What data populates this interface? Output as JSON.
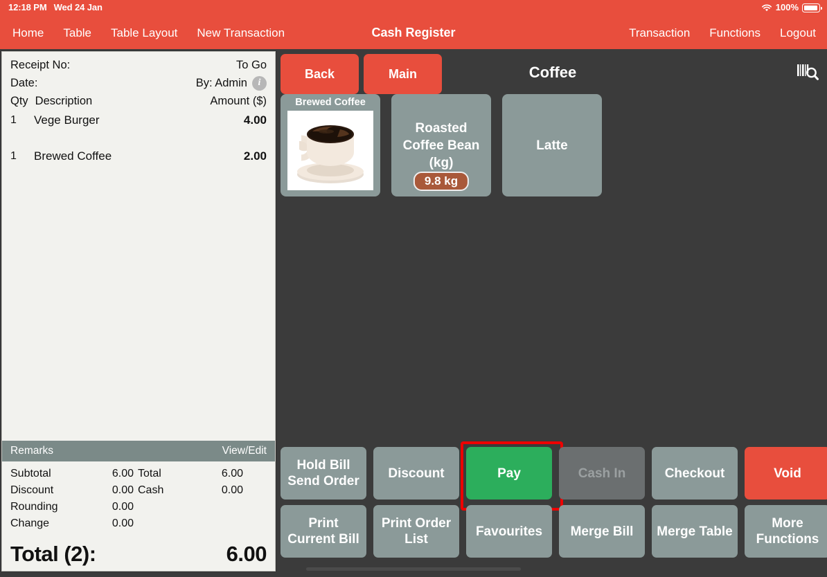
{
  "status_bar": {
    "time": "12:18 PM",
    "date": "Wed 24 Jan",
    "battery_percent": "100%",
    "wifi_icon": "wifi-icon",
    "battery_icon": "battery-icon"
  },
  "header": {
    "title": "Cash Register",
    "left_nav": [
      {
        "label": "Home"
      },
      {
        "label": "Table"
      },
      {
        "label": "Table Layout"
      },
      {
        "label": "New Transaction"
      }
    ],
    "right_nav": [
      {
        "label": "Transaction"
      },
      {
        "label": "Functions"
      },
      {
        "label": "Logout"
      }
    ]
  },
  "receipt": {
    "receipt_no_label": "Receipt No:",
    "receipt_no_value": "",
    "order_type": "To Go",
    "date_label": "Date:",
    "date_value": "",
    "by_label": "By: Admin",
    "info_icon": "info-icon",
    "columns": {
      "qty": "Qty",
      "description": "Description",
      "amount": "Amount ($)"
    },
    "items": [
      {
        "qty": "1",
        "description": "Vege Burger",
        "amount": "4.00"
      },
      {
        "qty": "1",
        "description": "Brewed Coffee",
        "amount": "2.00"
      }
    ],
    "remarks_label": "Remarks",
    "remarks_action": "View/Edit",
    "totals": [
      {
        "label": "Subtotal",
        "value": "6.00",
        "label2": "Total",
        "value2": "6.00"
      },
      {
        "label": "Discount",
        "value": "0.00",
        "label2": "Cash",
        "value2": "0.00"
      },
      {
        "label": "Rounding",
        "value": "0.00",
        "label2": "",
        "value2": ""
      },
      {
        "label": "Change",
        "value": "0.00",
        "label2": "",
        "value2": ""
      }
    ],
    "grand_label": "Total (2):",
    "grand_value": "6.00"
  },
  "catalog": {
    "back_label": "Back",
    "main_label": "Main",
    "category_title": "Coffee",
    "scan_icon": "barcode-search-icon",
    "products": [
      {
        "name": "Brewed Coffee",
        "layout": "image",
        "image": "coffee-cup-image",
        "badge": ""
      },
      {
        "name": "Roasted Coffee Bean (kg)",
        "layout": "text",
        "image": "",
        "badge": "9.8 kg"
      },
      {
        "name": "Latte",
        "layout": "text",
        "image": "",
        "badge": ""
      }
    ]
  },
  "functions": {
    "row1": [
      {
        "label": "Hold Bill\nSend Order",
        "style": "normal",
        "highlighted": false
      },
      {
        "label": "Discount",
        "style": "normal",
        "highlighted": false
      },
      {
        "label": "Pay",
        "style": "green",
        "highlighted": true
      },
      {
        "label": "Cash In",
        "style": "disabled",
        "highlighted": false
      },
      {
        "label": "Checkout",
        "style": "normal",
        "highlighted": false
      },
      {
        "label": "Void",
        "style": "red",
        "highlighted": false
      }
    ],
    "row2": [
      {
        "label": "Print\nCurrent Bill",
        "style": "normal",
        "highlighted": false
      },
      {
        "label": "Print Order\nList",
        "style": "normal",
        "highlighted": false
      },
      {
        "label": "Favourites",
        "style": "normal",
        "highlighted": false
      },
      {
        "label": "Merge Bill",
        "style": "normal",
        "highlighted": false
      },
      {
        "label": "Merge Table",
        "style": "normal",
        "highlighted": false
      },
      {
        "label": "More\nFunctions",
        "style": "normal",
        "highlighted": false
      }
    ]
  },
  "colors": {
    "brand_red": "#e84e3d",
    "pay_green": "#2cae5c",
    "tile_grey": "#8b9a99",
    "background": "#3b3b3b",
    "badge_brown": "#a9593a",
    "highlight_red": "#ee0000"
  }
}
